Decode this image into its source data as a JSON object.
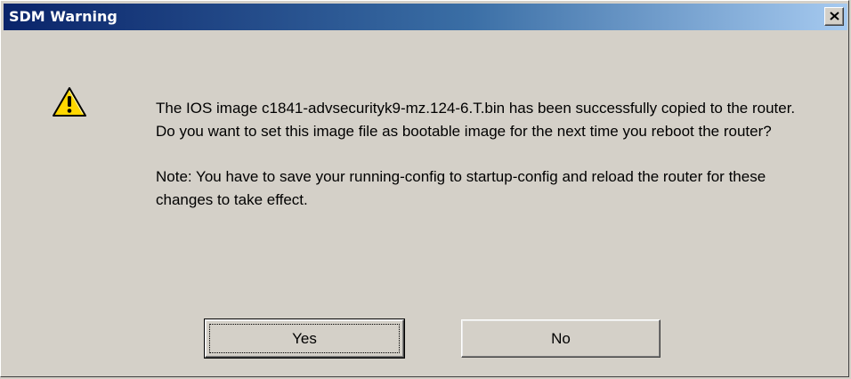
{
  "dialog": {
    "title": "SDM Warning",
    "icon": "warning-icon",
    "message": "The IOS image c1841-advsecurityk9-mz.124-6.T.bin has been successfully copied to the router. Do you want to set this image file as bootable image for the next time you reboot the router?",
    "note": "Note: You have to save your running-config to startup-config and reload the router for these changes to take effect.",
    "buttons": {
      "yes_label": "Yes",
      "no_label": "No"
    }
  },
  "colors": {
    "titlebar_start": "#0a246a",
    "titlebar_end": "#a6caf0",
    "window_bg": "#d4d0c8",
    "warning_yellow": "#ffd700"
  }
}
